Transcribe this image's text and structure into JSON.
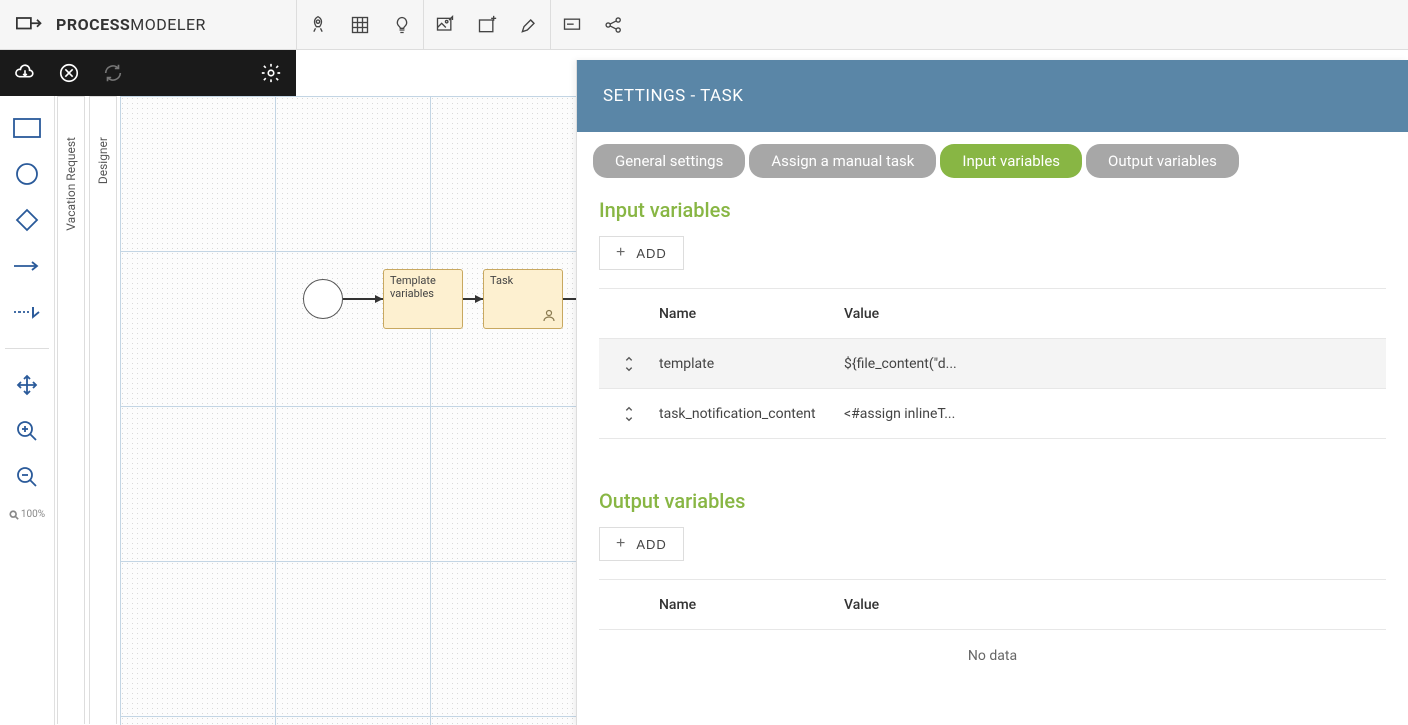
{
  "app": {
    "name_bold": "PROCESS",
    "name_light": "MODELER"
  },
  "vtabs": {
    "tab1": "Vacation Request",
    "tab2": "Designer"
  },
  "flow": {
    "node1": "Template variables",
    "node2": "Task"
  },
  "zoom": {
    "label": "100%"
  },
  "panel": {
    "title": "SETTINGS  -  TASK",
    "tabs": {
      "general": "General settings",
      "assign": "Assign a manual task",
      "input": "Input variables",
      "output": "Output variables"
    },
    "input": {
      "heading": "Input variables",
      "add": "ADD",
      "columns": {
        "name": "Name",
        "value": "Value"
      },
      "rows": [
        {
          "name": "template",
          "value": "${file_content(\"d..."
        },
        {
          "name": "task_notification_content",
          "value": "<#assign inlineT..."
        }
      ]
    },
    "output": {
      "heading": "Output variables",
      "add": "ADD",
      "columns": {
        "name": "Name",
        "value": "Value"
      },
      "nodata": "No data"
    }
  }
}
